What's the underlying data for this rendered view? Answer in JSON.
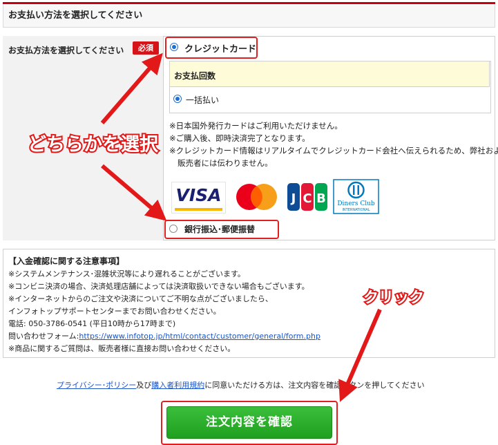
{
  "header": {
    "title": "お支払い方法を選択してください"
  },
  "payment": {
    "label": "お支払方法を選択してください",
    "required_badge": "必須",
    "credit": {
      "label": "クレジットカード",
      "selected": true,
      "installment_title": "お支払回数",
      "installment_option": "一括払い",
      "notes": [
        "※日本国外発行カードはご利用いただけません。",
        "※ご購入後、即時決済完了となります。",
        "※クレジットカード情報はリアルタイムでクレジットカード会社へ伝えられるため、弊社および",
        "販売者には伝わりません。"
      ],
      "card_brands": [
        "VISA",
        "Mastercard",
        "JCB",
        "Diners Club INTERNATIONAL"
      ],
      "visa_text": "VISA",
      "jcb_text": "JCB",
      "diners_text": "Diners Club",
      "diners_sub": "INTERNATIONAL"
    },
    "bank": {
      "label": "銀行振込･郵便振替",
      "selected": false
    }
  },
  "notice": {
    "title": "【入金確認に関する注意事項】",
    "lines": [
      "※システムメンテナンス･混雑状況等により遅れることがございます。",
      "※コンビニ決済の場合、決済処理店舗によっては決済取扱いできない場合もございます。",
      "※インターネットからのご注文や決済についてご不明な点がございましたら、",
      "インフォトップサポートセンターまでお問い合わせください。",
      "電話: 050-3786-0541 (平日10時から17時まで)"
    ],
    "form_label": "問い合わせフォーム:",
    "form_url": "https://www.infotop.jp/html/contact/customer/general/form.php",
    "last_line": "※商品に関するご質問は、販売者様に直接お問い合わせください。"
  },
  "agreement": {
    "privacy_link": "プライバシー･ポリシー",
    "and_text": "及び",
    "terms_link": "購入者利用規約",
    "rest_text": "に同意いただける方は、注文内容を確認ボタンを押してください"
  },
  "confirm_button": "注文内容を確認",
  "annotations": {
    "select_text": "どちらかを選択",
    "click_text": "クリック"
  },
  "colors": {
    "accent_red": "#e02020",
    "button_green": "#2db32d",
    "link_blue": "#1a54c7",
    "radio_blue": "#1e6fd0"
  }
}
